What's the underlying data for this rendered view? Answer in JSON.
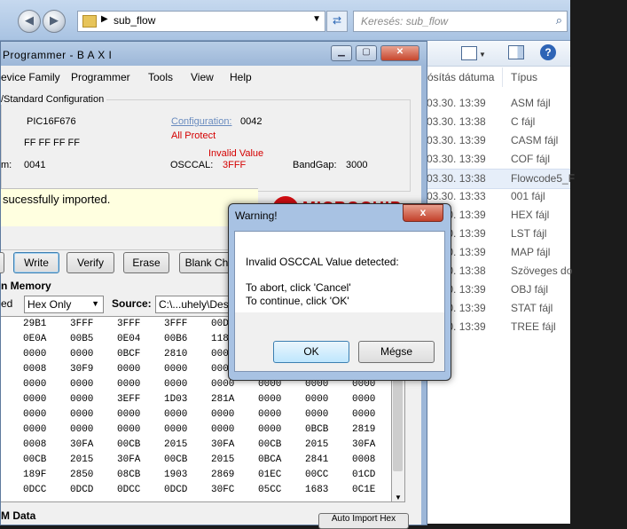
{
  "explorer": {
    "path": "sub_flow",
    "search_placeholder": "Keresés: sub_flow",
    "col_date": "ósítás dátuma",
    "col_type": "Típus",
    "files": [
      {
        "date": "03.30. 13:39",
        "type": "ASM fájl"
      },
      {
        "date": "03.30. 13:38",
        "type": "C fájl"
      },
      {
        "date": "03.30. 13:39",
        "type": "CASM fájl"
      },
      {
        "date": "03.30. 13:39",
        "type": "COF fájl"
      },
      {
        "date": "03.30. 13:38",
        "type": "Flowcode5_F"
      },
      {
        "date": "03.30. 13:33",
        "type": "001 fájl"
      },
      {
        "date": "03.30. 13:39",
        "type": "HEX fájl"
      },
      {
        "date": "03.30. 13:39",
        "type": "LST fájl"
      },
      {
        "date": "03.30. 13:39",
        "type": "MAP fájl"
      },
      {
        "date": "03.30. 13:38",
        "type": "Szöveges do"
      },
      {
        "date": "03.30. 13:39",
        "type": "OBJ fájl"
      },
      {
        "date": "03.30. 13:39",
        "type": "STAT fájl"
      },
      {
        "date": "03.30. 13:39",
        "type": "TREE fájl"
      }
    ]
  },
  "pickit": {
    "title": "Programmer - B A X I",
    "menu": [
      "evice Family",
      "Programmer",
      "Tools",
      "View",
      "Help"
    ],
    "config_legend": "/Standard Configuration",
    "device": "PIC16F676",
    "configuration_label": "Configuration:",
    "configuration_value": "0042",
    "all_protect": "All Protect",
    "ids": "FF FF FF FF",
    "checksum_label": "m:",
    "checksum": "0041",
    "invalid_value": "Invalid Value",
    "osccal_label": "OSCCAL:",
    "osccal_value": "3FFF",
    "bandgap_label": "BandGap:",
    "bandgap_value": "3000",
    "status_text": "sucessfully imported.",
    "logo_text": "MICROCHIP",
    "buttons": {
      "write": "Write",
      "verify": "Verify",
      "erase": "Erase",
      "blank": "Blank Ch"
    },
    "memory_title": "n Memory",
    "enabled_label": "ed",
    "hex_only": "Hex Only",
    "source_label": "Source:",
    "source_value": "C:\\...uhely\\Desk",
    "memory_rows": [
      [
        "29B1",
        "3FFF",
        "3FFF",
        "3FFF",
        "00D",
        "",
        "",
        ""
      ],
      [
        "0E0A",
        "00B5",
        "0E04",
        "00B6",
        "118",
        "",
        "",
        ""
      ],
      [
        "0000",
        "0000",
        "0BCF",
        "2810",
        "000",
        "",
        "",
        ""
      ],
      [
        "0008",
        "30F9",
        "0000",
        "0000",
        "000",
        "",
        "",
        ""
      ],
      [
        "0000",
        "0000",
        "0000",
        "0000",
        "0000",
        "0000",
        "0000",
        "0000"
      ],
      [
        "0000",
        "0000",
        "3EFF",
        "1D03",
        "281A",
        "0000",
        "0000",
        "0000"
      ],
      [
        "0000",
        "0000",
        "0000",
        "0000",
        "0000",
        "0000",
        "0000",
        "0000"
      ],
      [
        "0000",
        "0000",
        "0000",
        "0000",
        "0000",
        "0000",
        "0BCB",
        "2819"
      ],
      [
        "0008",
        "30FA",
        "00CB",
        "2015",
        "30FA",
        "00CB",
        "2015",
        "30FA"
      ],
      [
        "00CB",
        "2015",
        "30FA",
        "00CB",
        "2015",
        "0BCA",
        "2841",
        "0008"
      ],
      [
        "189F",
        "2850",
        "08CB",
        "1903",
        "2869",
        "01EC",
        "00CC",
        "01CD"
      ],
      [
        "0DCC",
        "0DCD",
        "0DCC",
        "0DCD",
        "30FC",
        "05CC",
        "1683",
        "0C1E"
      ]
    ],
    "eedata_title": "M Data",
    "eedata_button": "Auto Import Hex"
  },
  "dialog": {
    "title": "Warning!",
    "close": "x",
    "line1": "Invalid OSCCAL Value detected:",
    "line2": "To abort, click 'Cancel'",
    "line3": "To continue, click 'OK'",
    "ok": "OK",
    "cancel": "Mégse"
  }
}
